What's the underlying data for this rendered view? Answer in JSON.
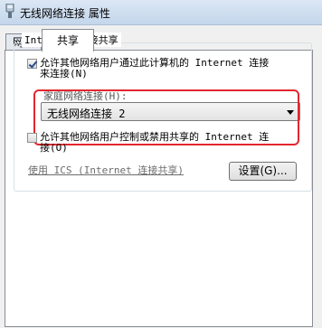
{
  "window": {
    "title": "无线网络连接 属性"
  },
  "tabs": [
    {
      "label": "网络"
    },
    {
      "label": "共享"
    }
  ],
  "ics_group": {
    "legend": "Internet 连接共享",
    "allow_sharing": {
      "checked": true,
      "line1": "允许其他网络用户通过此计算机的 Internet 连接",
      "line2": "来连接(N)"
    },
    "home_network": {
      "label": "家庭网络连接(H):",
      "selected": "无线网络连接 2"
    },
    "allow_control": {
      "checked": false,
      "line1": "允许其他网络用户控制或禁用共享的 Internet 连",
      "line2": "接(O)"
    },
    "ics_link": "使用 ICS (Internet 连接共享)",
    "settings_button": "设置(G)..."
  },
  "colors": {
    "highlight": "#e3262e",
    "border": "#898c95"
  }
}
